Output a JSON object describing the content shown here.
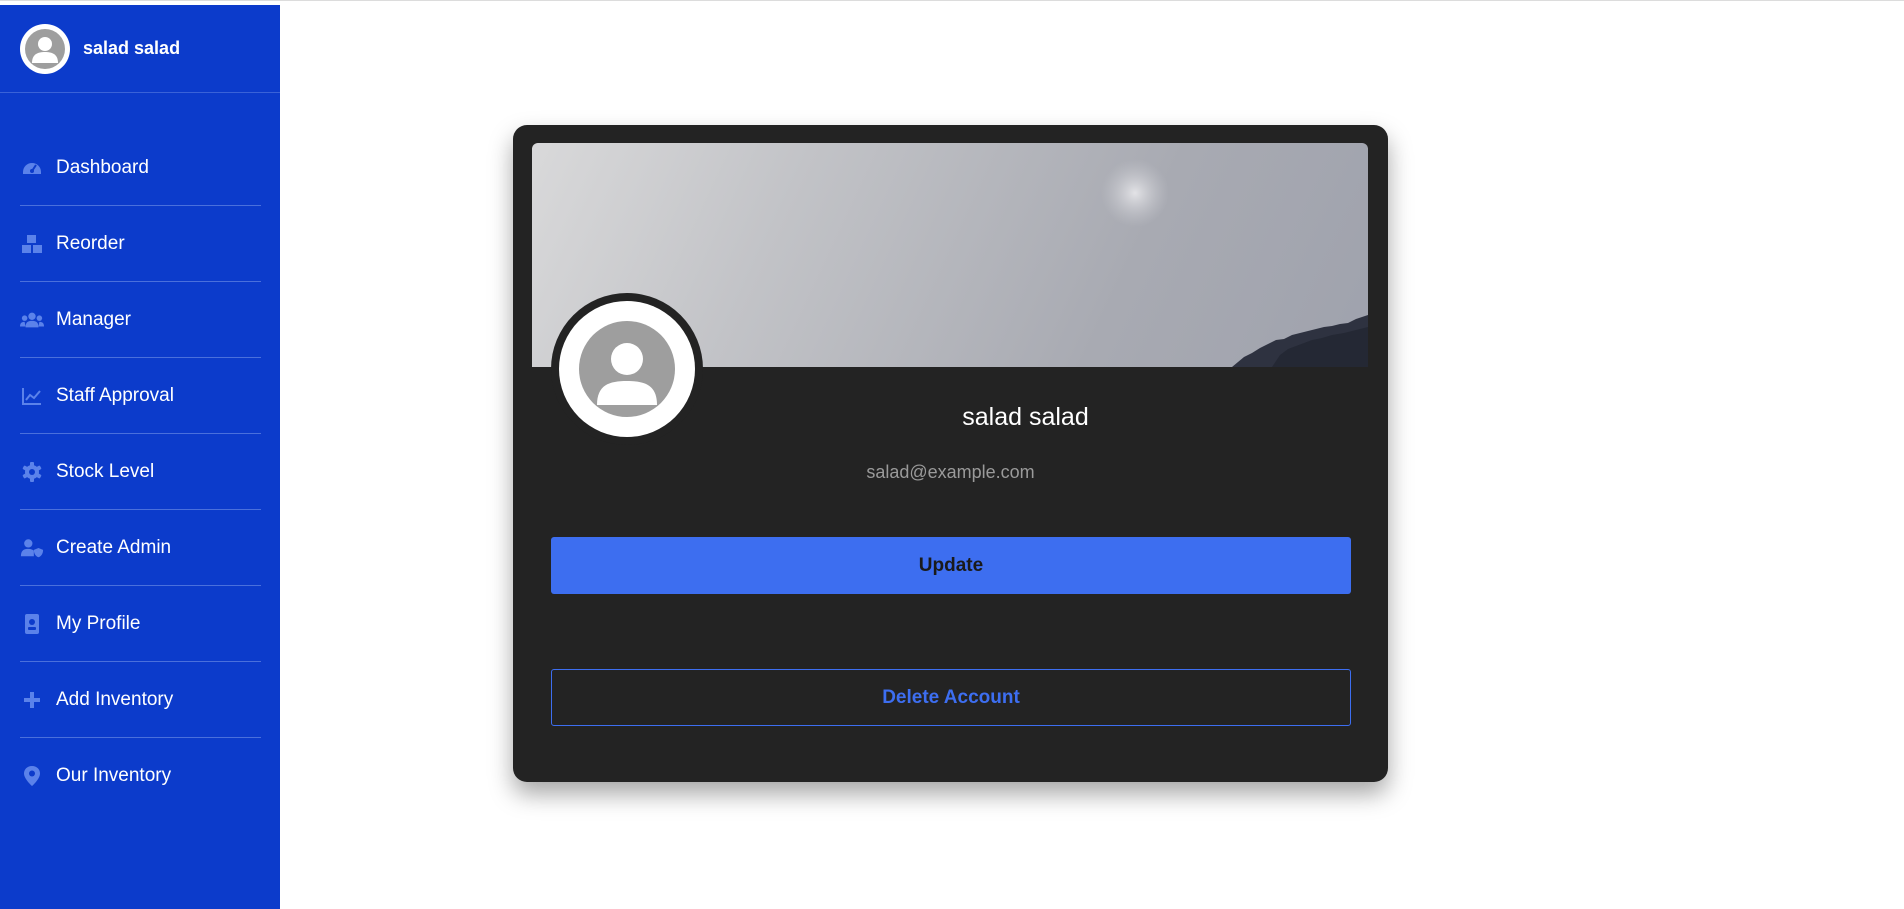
{
  "user": {
    "name": "salad salad",
    "email": "salad@example.com"
  },
  "sidebar": {
    "items": [
      {
        "label": "Dashboard",
        "icon": "dashboard-icon"
      },
      {
        "label": "Reorder",
        "icon": "boxes-icon"
      },
      {
        "label": "Manager",
        "icon": "users-icon"
      },
      {
        "label": "Staff Approval",
        "icon": "chart-line-icon"
      },
      {
        "label": "Stock Level",
        "icon": "gear-icon"
      },
      {
        "label": "Create Admin",
        "icon": "user-shield-icon"
      },
      {
        "label": "My Profile",
        "icon": "id-badge-icon"
      },
      {
        "label": "Add Inventory",
        "icon": "plus-icon"
      },
      {
        "label": "Our Inventory",
        "icon": "map-pin-icon"
      }
    ]
  },
  "profile_card": {
    "update_label": "Update",
    "delete_label": "Delete Account"
  },
  "colors": {
    "sidebar_bg": "#0c3bcb",
    "card_bg": "#232323",
    "accent": "#3d6ef0",
    "icon_tint": "#5b82ea"
  }
}
